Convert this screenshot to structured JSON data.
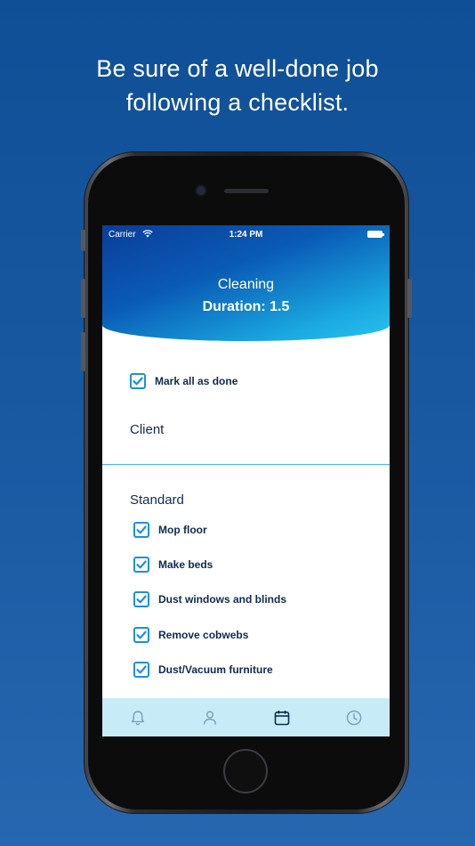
{
  "headline": {
    "line1": "Be sure of a well-done job",
    "line2": "following a checklist."
  },
  "status_bar": {
    "carrier": "Carrier",
    "time": "1:24 PM"
  },
  "header": {
    "title": "Cleaning",
    "duration": "Duration: 1.5"
  },
  "mark_all": {
    "label": "Mark all as done",
    "checked": true
  },
  "sections": {
    "client": "Client",
    "standard": "Standard"
  },
  "checklist": [
    {
      "label": "Mop floor",
      "checked": true
    },
    {
      "label": "Make beds",
      "checked": true
    },
    {
      "label": "Dust windows and blinds",
      "checked": true
    },
    {
      "label": "Remove cobwebs",
      "checked": true
    },
    {
      "label": "Dust/Vacuum furniture",
      "checked": true
    }
  ],
  "tab_bar": {
    "tabs": [
      {
        "icon": "bell-icon",
        "active": false
      },
      {
        "icon": "person-icon",
        "active": false
      },
      {
        "icon": "calendar-icon",
        "active": true
      },
      {
        "icon": "clock-icon",
        "active": false
      }
    ]
  },
  "colors": {
    "background": "#1a5aa3",
    "header_start": "#0a3e9a",
    "header_end": "#27c4ef",
    "checkbox": "#1e8fe0",
    "text": "#0f2b4f",
    "tab_bar": "#c7ecf8",
    "tab_inactive": "#7a9db8",
    "tab_active": "#0f2b4f"
  }
}
